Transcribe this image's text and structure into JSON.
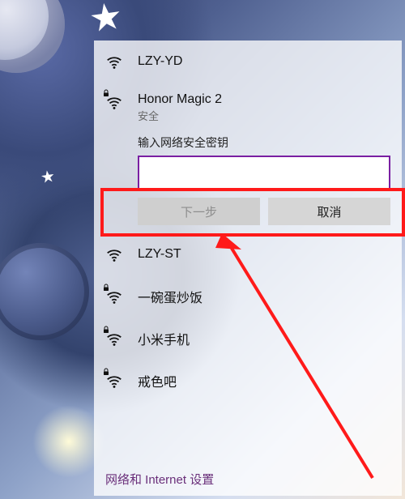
{
  "networks": [
    {
      "ssid": "LZY-YD",
      "secured": false
    },
    {
      "ssid": "Honor Magic 2",
      "secured": true,
      "subtitle": "安全",
      "expanded": true
    },
    {
      "ssid": "LZY-ST",
      "secured": false
    },
    {
      "ssid": "一碗蛋炒饭",
      "secured": true
    },
    {
      "ssid": "小米手机",
      "secured": true
    },
    {
      "ssid": "戒色吧",
      "secured": true
    }
  ],
  "password_prompt": {
    "label": "输入网络安全密钥",
    "value": "",
    "next": "下一步",
    "cancel": "取消"
  },
  "footer_link": "网络和 Internet 设置"
}
